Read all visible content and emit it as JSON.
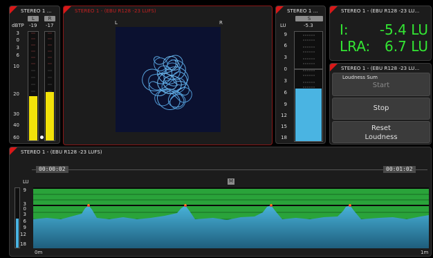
{
  "true_peak": {
    "title": "STEREO 1 ...",
    "unit": "dBTP",
    "left": {
      "label": "L",
      "value": "-19"
    },
    "right": {
      "label": "R",
      "value": "-17"
    },
    "scale": [
      "3",
      "0",
      "3",
      "6",
      "10",
      "20",
      "30",
      "40",
      "60"
    ],
    "left_level_fraction": 0.42,
    "right_level_fraction": 0.45
  },
  "vectorscope": {
    "title": "STEREO 1 - (EBU R128 -23 LUFS)",
    "left_label": "L",
    "right_label": "R"
  },
  "short_term": {
    "title": "STEREO 1 ...",
    "channel": "S",
    "unit": "LU",
    "value": "-5.3",
    "scale": [
      "9",
      "6",
      "3",
      "0",
      "3",
      "6",
      "9",
      "12",
      "15",
      "18"
    ],
    "level_fraction": 0.57
  },
  "integrated": {
    "title": "STEREO 1 - (EBU R128 -23 LU...",
    "i_label": "I:",
    "i_value": "-5.4",
    "i_unit": "LU",
    "lra_label": "LRA:",
    "lra_value": "6.7",
    "lra_unit": "LU"
  },
  "loudness_sum": {
    "title": "STEREO 1 - (EBU R128 -23 LU...",
    "subtitle": "Loudness Sum",
    "start_label": "Start",
    "stop_label": "Stop",
    "reset_label_line1": "Reset",
    "reset_label_line2": "Loudness"
  },
  "history": {
    "title": "STEREO 1 - (EBU R128 -23 LUFS)",
    "time_start": "00:00:02",
    "time_end": "00:01:02",
    "mode_label": "M",
    "unit": "LU",
    "scale": [
      "9",
      "3",
      "0",
      "3",
      "6",
      "9",
      "12",
      "18"
    ],
    "x_start": "0m",
    "x_end": "1m"
  },
  "colors": {
    "accent_red": "#d81818",
    "peak_yellow": "#f2e20a",
    "loudness_blue": "#4ab4e2",
    "lu_green": "#33e633",
    "history_green": "#2aa33a"
  }
}
